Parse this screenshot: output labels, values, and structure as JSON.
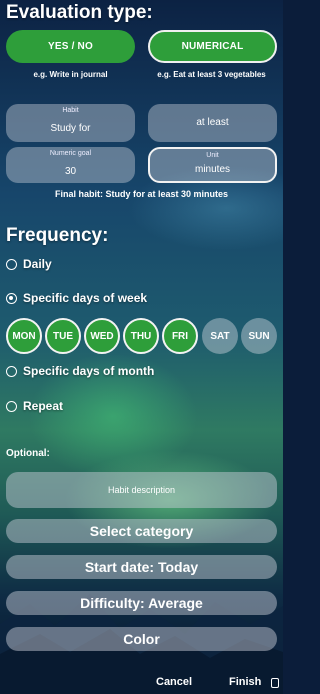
{
  "evaluation": {
    "title": "Evaluation type:",
    "yes_no_label": "YES / NO",
    "numerical_label": "NUMERICAL",
    "yes_no_hint": "e.g. Write in journal",
    "numerical_hint": "e.g. Eat at least 3 vegetables"
  },
  "habit": {
    "habit_label": "Habit",
    "habit_value": "Study for",
    "condition_value": "at least",
    "goal_label": "Numeric goal",
    "goal_value": "30",
    "unit_label": "Unit",
    "unit_value": "minutes",
    "final_text": "Final habit: Study for at least 30 minutes"
  },
  "frequency": {
    "title": "Frequency:",
    "options": [
      "Daily",
      "Specific days of week",
      "Specific days of month",
      "Repeat"
    ],
    "selected": "Specific days of week",
    "days": [
      {
        "label": "MON",
        "selected": true
      },
      {
        "label": "TUE",
        "selected": true
      },
      {
        "label": "WED",
        "selected": true
      },
      {
        "label": "THU",
        "selected": true
      },
      {
        "label": "FRI",
        "selected": true
      },
      {
        "label": "SAT",
        "selected": false
      },
      {
        "label": "SUN",
        "selected": false
      }
    ]
  },
  "optional": {
    "title": "Optional:",
    "description_placeholder": "Habit description",
    "category_label": "Select category",
    "start_date_label": "Start date: Today",
    "difficulty_label": "Difficulty: Average",
    "color_label": "Color"
  },
  "footer": {
    "cancel_label": "Cancel",
    "finish_label": "Finish"
  },
  "colors": {
    "accent_green": "#2e9e3a",
    "field_gray": "#cdd2dc"
  }
}
